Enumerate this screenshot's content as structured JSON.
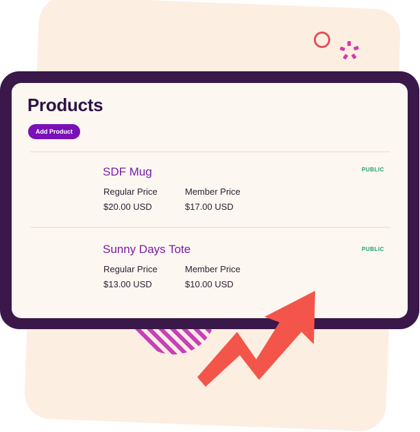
{
  "page": {
    "title": "Products",
    "add_button_label": "Add Product"
  },
  "products": [
    {
      "name": "SDF Mug",
      "status": "PUBLIC",
      "regular_label": "Regular Price",
      "regular_price": "$20.00 USD",
      "member_label": "Member Price",
      "member_price": "$17.00 USD"
    },
    {
      "name": "Sunny Days Tote",
      "status": "PUBLIC",
      "regular_label": "Regular Price",
      "regular_price": "$13.00 USD",
      "member_label": "Member Price",
      "member_price": "$10.00 USD"
    }
  ],
  "decorations": {
    "ring_icon": "ring-icon",
    "dots_icon": "dotted-circle-icon",
    "stripes": "striped-circle",
    "arrow_icon": "trend-up-arrow-icon"
  },
  "colors": {
    "frame": "#3a1849",
    "panel": "#fdf7f2",
    "accent_purple": "#7a10b7",
    "status_green": "#1aa45f",
    "arrow_red": "#f4554a",
    "background_card": "#fdeee2"
  }
}
